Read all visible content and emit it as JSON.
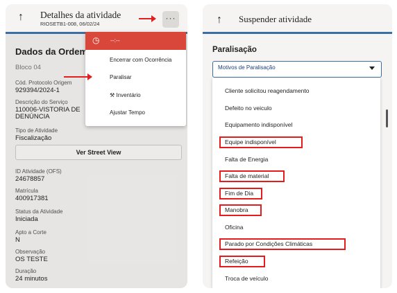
{
  "left": {
    "header": {
      "title": "Detalhes da atividade",
      "subtitle": "RIOSETB1-008, 06/02/24",
      "back_icon": "↑",
      "more_icon": "···"
    },
    "section_title": "Dados da Ordem",
    "bloco": "Bloco 04",
    "fields": [
      {
        "label": "Cód. Protocolo Origem",
        "value": "929394/2024-1"
      },
      {
        "label": "Descrição do Serviço",
        "value": "110006-VISTORIA DE",
        "value2": "DENÚNCIA"
      },
      {
        "label": "Tipo de Atividade",
        "value": "Fiscalização"
      }
    ],
    "street_view_label": "Ver Street View",
    "fields2": [
      {
        "label": "ID Atividade (OFS)",
        "value": "24678857"
      },
      {
        "label": "Matrícula",
        "value": "400917381"
      },
      {
        "label": "Status da Atividade",
        "value": "Iniciada"
      },
      {
        "label": "Apto a Corte",
        "value": "N"
      },
      {
        "label": "Observação",
        "value": "OS TESTE"
      },
      {
        "label": "Duração",
        "value": "24 minutos"
      }
    ],
    "menu": {
      "top_label": "--:--",
      "items": [
        "Encerrar com Ocorrência",
        "Paralisar",
        "Inventário",
        "Ajustar Tempo"
      ]
    },
    "arrow_color": "#e02020"
  },
  "right": {
    "header": {
      "title": "Suspender atividade",
      "back_icon": "↑"
    },
    "section_title": "Paralisação",
    "select_label": "Motivos de Paralisação",
    "options": [
      "Cliente solicitou reagendamento",
      "Defeito no veiculo",
      "Equipamento indisponível",
      "Equipe indisponível",
      "Falta de Energia",
      "Falta de material",
      "Fim de Dia",
      "Manobra",
      "Oficina",
      "Parado por Condições Climáticas",
      "Refeição",
      "Troca de veículo"
    ],
    "highlighted": [
      "Equipe indisponível",
      "Falta de material",
      "Fim de Dia",
      "Manobra",
      "Parado por Condições Climáticas",
      "Refeição"
    ],
    "highlight_color": "#e51c1c"
  }
}
